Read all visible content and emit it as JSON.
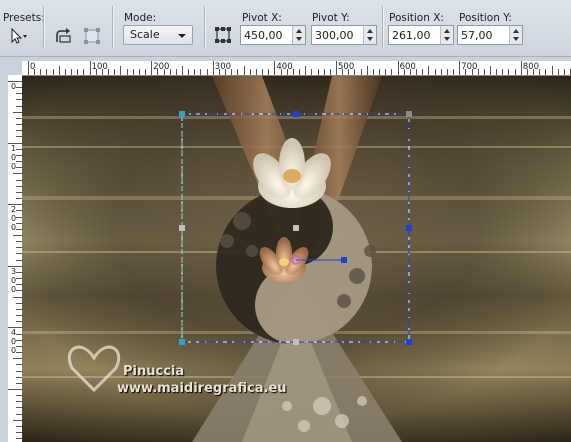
{
  "toolbar": {
    "presets_label": "Presets:",
    "mode_label": "Mode:",
    "mode_value": "Scale",
    "pivot_x_label": "Pivot X:",
    "pivot_x_value": "450,00",
    "pivot_y_label": "Pivot Y:",
    "pivot_y_value": "300,00",
    "position_x_label": "Position X:",
    "position_x_value": "261,00",
    "position_y_label": "Position Y:",
    "position_y_value": "57,00"
  },
  "ruler": {
    "horizontal": [
      "0",
      "100",
      "200",
      "300",
      "400",
      "500",
      "600",
      "700",
      "800"
    ],
    "vertical": [
      [
        "0"
      ],
      [
        "1",
        "0",
        "0"
      ],
      [
        "2",
        "0",
        "0"
      ],
      [
        "3",
        "0",
        "0"
      ],
      [
        "4",
        "0",
        "0"
      ]
    ]
  },
  "watermark": {
    "name": "Pinuccia",
    "site": "www.maidiregrafica.eu"
  },
  "colors": {
    "selection_handle": "#1f3fd8",
    "pivot_handle": "#2aa6c8",
    "guide": "#ffffff"
  }
}
